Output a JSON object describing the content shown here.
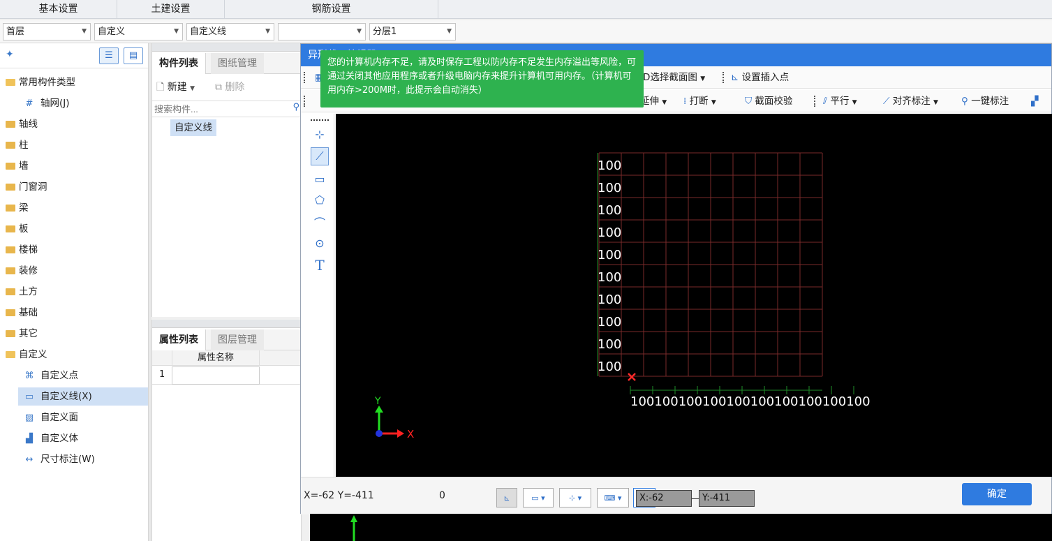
{
  "top_tabs": [
    "基本设置",
    "土建设置",
    "钢筋设置"
  ],
  "combos": [
    {
      "value": "首层"
    },
    {
      "value": "自定义"
    },
    {
      "value": "自定义线"
    },
    {
      "value": ""
    },
    {
      "value": "分层1"
    }
  ],
  "tree": {
    "root_label": "常用构件类型",
    "axis_grid": "轴网(J)",
    "folders": [
      "轴线",
      "柱",
      "墙",
      "门窗洞",
      "梁",
      "板",
      "楼梯",
      "装修",
      "土方",
      "基础",
      "其它"
    ],
    "custom_folder": "自定义",
    "custom_items": [
      "自定义点",
      "自定义线(X)",
      "自定义面",
      "自定义体",
      "尺寸标注(W)"
    ]
  },
  "component_panel": {
    "tab_active": "构件列表",
    "tab_inactive": "图纸管理",
    "new_label": "新建",
    "delete_label": "删除",
    "search_placeholder": "搜索构件...",
    "items": [
      "自定义线"
    ]
  },
  "property_panel": {
    "tab_active": "属性列表",
    "tab_inactive": "图层管理",
    "column_header": "属性名称",
    "row_number": "1"
  },
  "dialog": {
    "title": "异形截面编辑器",
    "toolbar1": {
      "select_section": "D选择截面图",
      "set_insert_point": "设置插入点"
    },
    "toolbar2": {
      "extend": "延伸",
      "break": "打断",
      "section_check": "截面校验",
      "parallel": "平行",
      "align_dim": "对齐标注",
      "one_key_dim": "一键标注"
    },
    "canvas": {
      "row_labels": [
        "100",
        "100",
        "100",
        "100",
        "100",
        "100",
        "100",
        "100",
        "100",
        "100"
      ],
      "col_labels": "100100100100100100100100100100",
      "axis_x": "X",
      "axis_y": "Y"
    },
    "status": {
      "cursor": "X=-62 Y=-411",
      "zero": "0",
      "x_value": "X:-62",
      "y_value": "Y:-411",
      "ok": "确定"
    }
  },
  "tooltip": {
    "text": "您的计算机内存不足，请及时保存工程以防内存不足发生内存溢出等风险，可通过关闭其他应用程序或者升级电脑内存来提升计算机可用内存。（计算机可用内存>200M时，此提示会自动消失）"
  }
}
